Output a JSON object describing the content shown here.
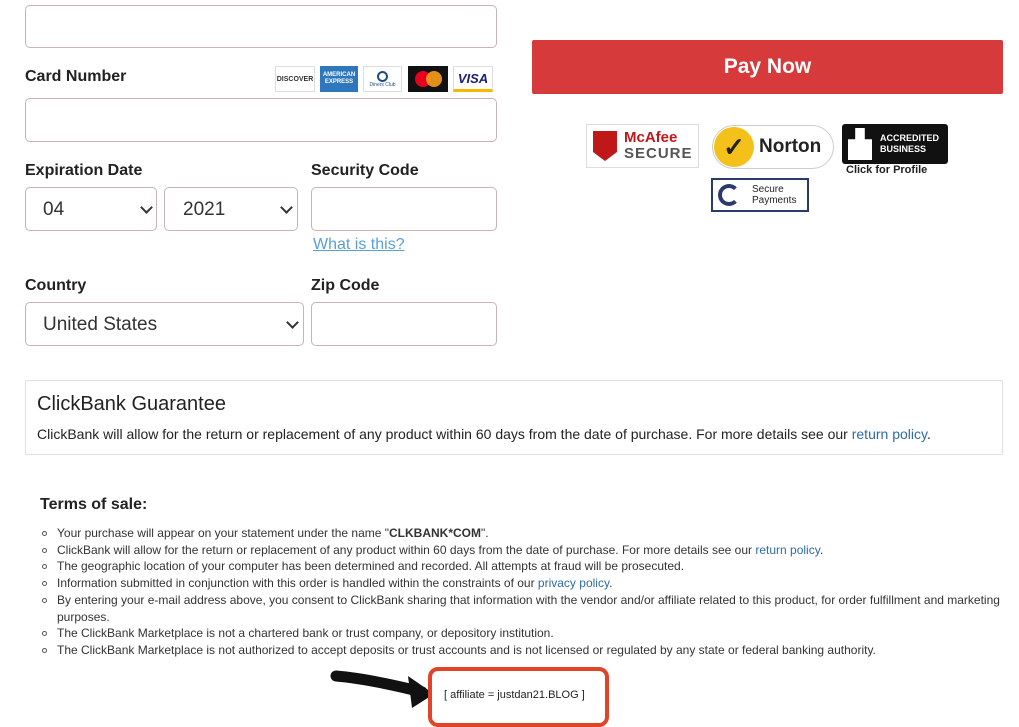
{
  "form": {
    "card_number_label": "Card Number",
    "expiration_label": "Expiration Date",
    "exp_month": "04",
    "exp_year": "2021",
    "security_code_label": "Security Code",
    "what_is_this": "What is this?",
    "country_label": "Country",
    "country_value": "United States",
    "zip_label": "Zip Code"
  },
  "cards": {
    "discover": "DISCOVER",
    "amex": "AMERICAN EXPRESS",
    "diners": "Diners Club",
    "visa": "VISA"
  },
  "pay_button": "Pay Now",
  "badges": {
    "mcafee_line1": "McAfee",
    "mcafee_line2": "SECURE",
    "norton": "Norton",
    "bbb_line1": "ACCREDITED",
    "bbb_line2": "BUSINESS",
    "bbb_caption": "Click for Profile",
    "secure_line1": "Secure",
    "secure_line2": "Payments"
  },
  "guarantee": {
    "title": "ClickBank Guarantee",
    "text": "ClickBank will allow for the return or replacement of any product within 60 days from the date of purchase. For more details see our ",
    "link": "return policy",
    "end": "."
  },
  "terms": {
    "title": "Terms of sale:",
    "item1_pre": "Your purchase will appear on your statement under the name \"",
    "item1_bold": "CLKBANK*COM",
    "item1_post": "\".",
    "item2_pre": "ClickBank will allow for the return or replacement of any product within 60 days from the date of purchase. For more details see our ",
    "item2_link": "return policy",
    "item2_post": ".",
    "item3": "The geographic location of your computer has been determined and recorded. All attempts at fraud will be prosecuted.",
    "item4_pre": "Information submitted in conjunction with this order is handled within the constraints of our ",
    "item4_link": "privacy policy",
    "item4_post": ".",
    "item5": "By entering your e-mail address above, you consent to ClickBank sharing that information with the vendor and/or affiliate related to this product, for order fulfillment and marketing purposes.",
    "item6": "The ClickBank Marketplace is not a chartered bank or trust company, or depository institution.",
    "item7": "The ClickBank Marketplace is not authorized to accept deposits or trust accounts and is not licensed or regulated by any state or federal banking authority."
  },
  "affiliate": "[ affiliate = justdan21.BLOG ]",
  "colors": {
    "pay_button": "#d63a3a",
    "link": "#2e6aa8",
    "highlight_box": "#e0452a"
  }
}
